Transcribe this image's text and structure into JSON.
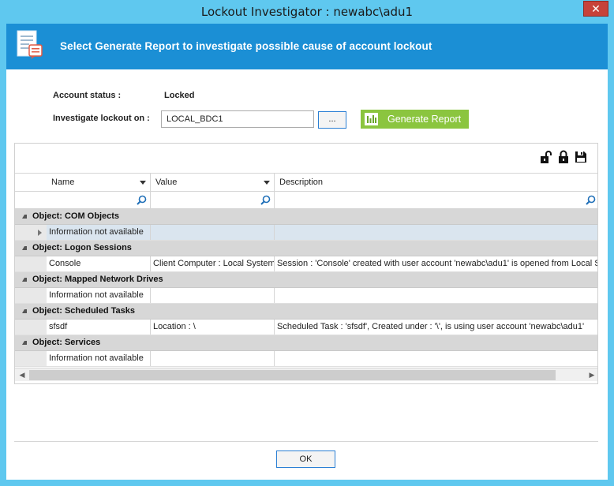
{
  "window": {
    "title": "Lockout Investigator : newabc\\adu1",
    "close_glyph": "✕"
  },
  "banner": {
    "text": "Select Generate Report to investigate possible cause of account lockout",
    "icon": "report-document-icon"
  },
  "form": {
    "account_status_label": "Account status :",
    "account_status_value": "Locked",
    "investigate_label": "Investigate lockout on :",
    "server_value": "LOCAL_BDC1",
    "browse_label": "...",
    "generate_label": "Generate Report"
  },
  "toolbar": {
    "icons": [
      "unlock-icon",
      "lock-icon",
      "save-icon"
    ]
  },
  "grid": {
    "columns": [
      {
        "label": "Name"
      },
      {
        "label": "Value"
      },
      {
        "label": "Description"
      }
    ],
    "groups": [
      {
        "label": "Object: COM Objects",
        "rows": [
          {
            "name": "Information not available",
            "value": "",
            "description": "",
            "selected": true,
            "expandable": true
          }
        ]
      },
      {
        "label": "Object: Logon Sessions",
        "rows": [
          {
            "name": "Console",
            "value": "Client Computer : Local System",
            "description": "Session : 'Console' created with user account 'newabc\\adu1' is opened from Local System"
          }
        ]
      },
      {
        "label": "Object: Mapped Network Drives",
        "rows": [
          {
            "name": "Information not available",
            "value": "",
            "description": ""
          }
        ]
      },
      {
        "label": "Object: Scheduled Tasks",
        "rows": [
          {
            "name": "sfsdf",
            "value": "Location : \\",
            "description": "Scheduled Task : 'sfsdf', Created under : '\\', is using user account 'newabc\\adu1'"
          }
        ]
      },
      {
        "label": "Object: Services",
        "rows": [
          {
            "name": "Information not available",
            "value": "",
            "description": ""
          }
        ]
      }
    ]
  },
  "footer": {
    "ok_label": "OK"
  },
  "colors": {
    "title_bar": "#5fc8ef",
    "banner": "#1b8fd5",
    "generate_button": "#8bc53f",
    "close_button": "#c7423a",
    "group_row": "#d7d7d7",
    "selected_row": "#dae5ef"
  }
}
